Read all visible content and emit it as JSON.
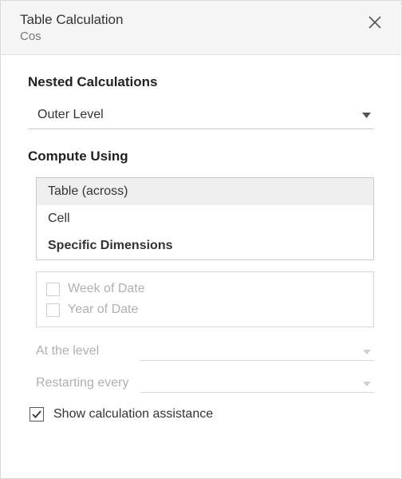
{
  "header": {
    "title": "Table Calculation",
    "subtitle": "Cos"
  },
  "nested": {
    "heading": "Nested Calculations",
    "selected": "Outer Level"
  },
  "compute": {
    "heading": "Compute Using",
    "options": {
      "table_across": "Table (across)",
      "cell": "Cell",
      "specific": "Specific Dimensions"
    }
  },
  "dimensions": {
    "week": "Week of Date",
    "year": "Year of Date"
  },
  "level": {
    "label": "At the level"
  },
  "restarting": {
    "label": "Restarting every"
  },
  "assist": {
    "label": "Show calculation assistance",
    "checked": true
  }
}
